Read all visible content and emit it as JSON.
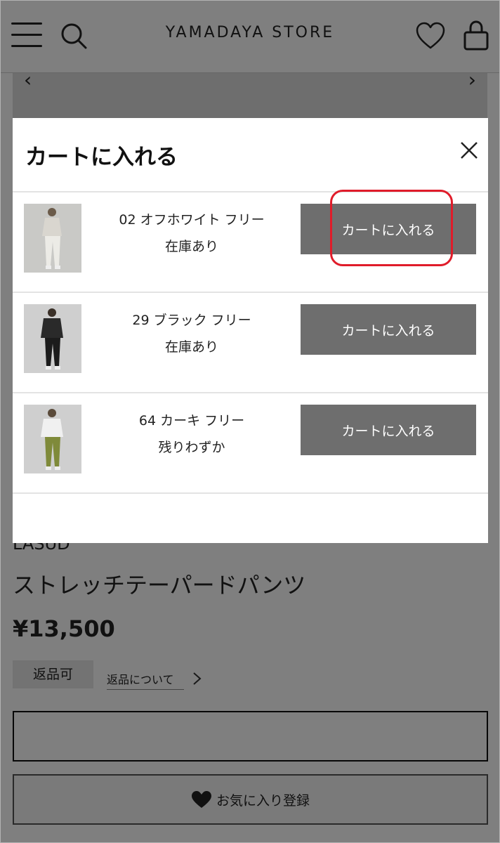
{
  "header": {
    "logo": "YAMADAYA STORE",
    "menu_icon": "hamburger-menu-icon",
    "search_icon": "search-icon",
    "favorite_icon": "heart-icon",
    "cart_icon": "shopping-bag-icon"
  },
  "hero": {
    "prev": "‹",
    "next": "›"
  },
  "product": {
    "brand": "LASUD",
    "name": "ストレッチテーパードパンツ",
    "price": "¥13,500",
    "return_badge": "返品可",
    "return_link": "返品について",
    "favorite_button": "お気に入り登録"
  },
  "modal": {
    "title": "カートに入れる",
    "close_icon": "close-icon",
    "variants": [
      {
        "name": "02 オフホワイト フリー",
        "stock": "在庫あり",
        "button": "カートに入れる",
        "thumb_color": "#e6e4dd"
      },
      {
        "name": "29 ブラック フリー",
        "stock": "在庫あり",
        "button": "カートに入れる",
        "thumb_color": "#262626"
      },
      {
        "name": "64 カーキ フリー",
        "stock": "残りわずか",
        "button": "カートに入れる",
        "thumb_color": "#7f8a3a"
      }
    ]
  },
  "colors": {
    "overlay": "rgba(0,0,0,0.5)",
    "cart_button": "#6e6e6e",
    "highlight": "#e01c2a"
  }
}
